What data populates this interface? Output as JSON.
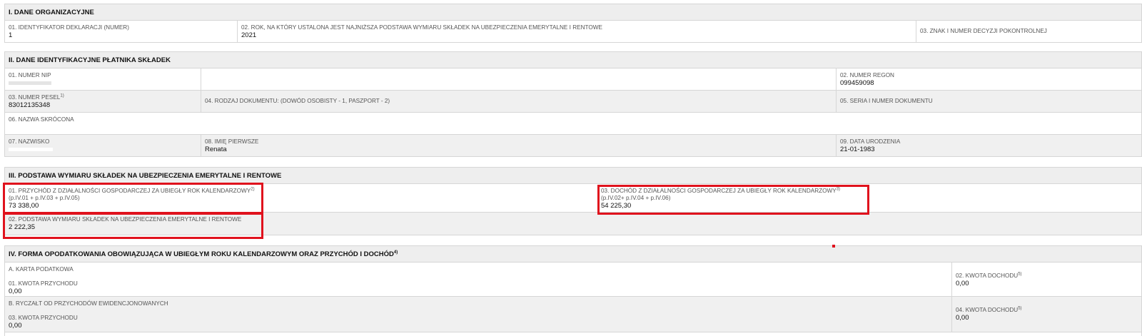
{
  "sec1": {
    "title": "I. DANE ORGANIZACYJNE",
    "f01_label": "01. IDENTYFIKATOR DEKLARACJI (NUMER)",
    "f01_value": "1",
    "f02_label": "02. ROK, NA KTÓRY USTALONA JEST NAJNIŻSZA PODSTAWA WYMIARU SKŁADEK NA UBEZPIECZENIA EMERYTALNE I RENTOWE",
    "f02_value": "2021",
    "f03_label": "03. ZNAK I NUMER DECYZJI POKONTROLNEJ"
  },
  "sec2": {
    "title": "II. DANE IDENTYFIKACYJNE PŁATNIKA SKŁADEK",
    "nip_label": "01. NUMER NIP",
    "regon_label": "02. NUMER REGON",
    "regon_value": "099459098",
    "pesel_label": "03. NUMER PESEL",
    "pesel_sup": "1)",
    "pesel_value": "83012135348",
    "doc_type_label": "04. RODZAJ DOKUMENTU: (DOWÓD OSOBISTY - 1, PASZPORT - 2)",
    "doc_series_label": "05. SERIA I NUMER DOKUMENTU",
    "short_name_label": "06. NAZWA SKRÓCONA",
    "surname_label": "07. NAZWISKO",
    "first_name_label": "08. IMIĘ PIERWSZE",
    "first_name_value": "Renata",
    "birth_label": "09. DATA URODZENIA",
    "birth_value": "21-01-1983"
  },
  "sec3": {
    "title": "III. PODSTAWA WYMIARU SKŁADEK NA UBEZPIECZENIA EMERYTALNE I RENTOWE",
    "f01_label": "01. PRZYCHÓD Z DZIAŁALNOŚCI GOSPODARCZEJ ZA UBIEGŁY ROK KALENDARZOWY",
    "f01_sup": "2)",
    "f01_formula": "(p.IV.01 + p.IV.03 + p.IV.05)",
    "f01_value": "73 338,00",
    "f03_label": "03. DOCHÓD Z DZIAŁALNOŚCI GOSPODARCZEJ ZA UBIEGŁY ROK KALENDARZOWY",
    "f03_sup": "3)",
    "f03_formula": "(p.IV.02+ p.IV.04 + p.IV.06)",
    "f03_value": "54 225,30",
    "f02_label": "02. PODSTAWA WYMIARU SKŁADEK NA UBEZPIECZENIA EMERYTALNE I RENTOWE",
    "f02_value": "2 222,35"
  },
  "sec4": {
    "title": "IV. FORMA OPODATKOWANIA OBOWIĄZUJĄCA W UBIEGŁYM ROKU KALENDARZOWYM ORAZ PRZYCHÓD I DOCHÓD",
    "title_sup": "4)",
    "a_title": "A. KARTA PODATKOWA",
    "a01_label": "01. KWOTA PRZYCHODU",
    "a01_value": "0,00",
    "a02_label": "02. KWOTA DOCHODU",
    "a02_sup": "5)",
    "a02_value": "0,00",
    "b_title": "B. RYCZAŁT OD PRZYCHODÓW EWIDENCJONOWANYCH",
    "b03_label": "03. KWOTA PRZYCHODU",
    "b03_value": "0,00",
    "b04_label": "04. KWOTA DOCHODU",
    "b04_sup": "5)",
    "b04_value": "0,00"
  }
}
